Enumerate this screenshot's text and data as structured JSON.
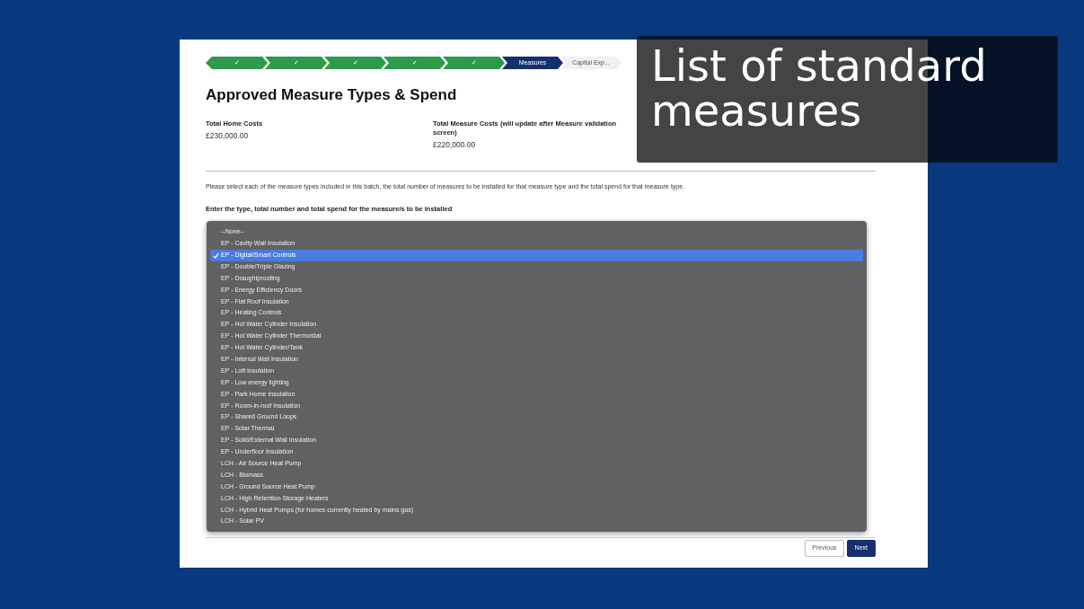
{
  "slide_caption": "List of standard measures",
  "progress_steps": [
    {
      "label": "✓",
      "complete": true,
      "selected": false
    },
    {
      "label": "✓",
      "complete": true,
      "selected": false
    },
    {
      "label": "✓",
      "complete": true,
      "selected": false
    },
    {
      "label": "✓",
      "complete": true,
      "selected": false
    },
    {
      "label": "✓",
      "complete": true,
      "selected": false
    },
    {
      "label": "Measures",
      "complete": false,
      "selected": true
    },
    {
      "label": "Capital Exp...",
      "complete": false,
      "selected": false
    }
  ],
  "page_title": "Approved Measure Types & Spend",
  "summary": [
    {
      "label": "Total Home Costs",
      "value": "£230,000.00"
    },
    {
      "label": "Total Measure Costs (will update after Measure validation screen)",
      "value": "£220,000.00"
    }
  ],
  "instructions": "Please select each of the measure types included in this batch, the total number of measures to be installed for that measure type and the total spend for that measure type.",
  "entry_prompt": "Enter the type, total number and total spend for the measure/s to be installed",
  "measure_dropdown": {
    "options": [
      {
        "label": "--None--",
        "selected": false
      },
      {
        "label": "EP - Cavity Wall Insulation",
        "selected": false
      },
      {
        "label": "EP - Digital/Smart Controls",
        "selected": true
      },
      {
        "label": "EP - Double/Triple Glazing",
        "selected": false
      },
      {
        "label": "EP - Draughtproofing",
        "selected": false
      },
      {
        "label": "EP - Energy Efficiency Doors",
        "selected": false
      },
      {
        "label": "EP - Flat Roof Insulation",
        "selected": false
      },
      {
        "label": "EP - Heating Controls",
        "selected": false
      },
      {
        "label": "EP - Hot Water Cylinder Insulation",
        "selected": false
      },
      {
        "label": "EP - Hot Water Cylinder Thermostat",
        "selected": false
      },
      {
        "label": "EP - Hot Water Cylinder/Tank",
        "selected": false
      },
      {
        "label": "EP - Internal Wall Insulation",
        "selected": false
      },
      {
        "label": "EP - Loft Insulation",
        "selected": false
      },
      {
        "label": "EP - Low energy lighting",
        "selected": false
      },
      {
        "label": "EP - Park Home Insulation",
        "selected": false
      },
      {
        "label": "EP - Room-in-roof Insulation",
        "selected": false
      },
      {
        "label": "EP - Shared Ground Loops",
        "selected": false
      },
      {
        "label": "EP - Solar Thermal",
        "selected": false
      },
      {
        "label": "EP - Solid/External Wall Insulation",
        "selected": false
      },
      {
        "label": "EP - Underfloor Insulation",
        "selected": false
      },
      {
        "label": "LCH - Air Source Heat Pump",
        "selected": false
      },
      {
        "label": "LCH - Biomass",
        "selected": false
      },
      {
        "label": "LCH - Ground Source Heat Pump",
        "selected": false
      },
      {
        "label": "LCH - High Retention Storage Heaters",
        "selected": false
      },
      {
        "label": "LCH - Hybrid Heat Pumps (for homes currently heated by mains gas)",
        "selected": false
      },
      {
        "label": "LCH - Solar PV",
        "selected": false
      }
    ]
  },
  "buttons": [
    {
      "label": "Previous",
      "kind": "secondary"
    },
    {
      "label": "Next",
      "kind": "primary"
    }
  ]
}
